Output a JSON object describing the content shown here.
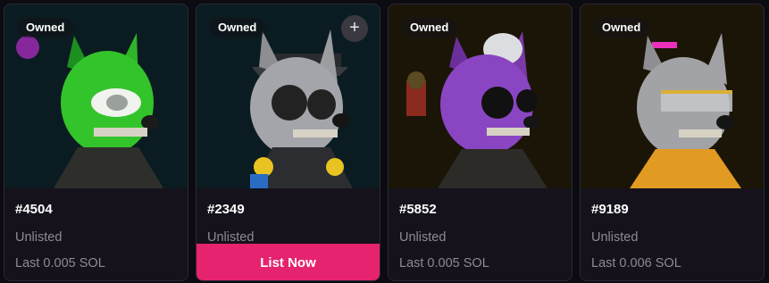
{
  "cards": [
    {
      "badge": "Owned",
      "token": "#4504",
      "status": "Unlisted",
      "last": "Last 0.005 SOL"
    },
    {
      "badge": "Owned",
      "token": "#2349",
      "status": "Unlisted",
      "last": "",
      "action": "List Now",
      "has_add": true
    },
    {
      "badge": "Owned",
      "token": "#5852",
      "status": "Unlisted",
      "last": "Last 0.005 SOL"
    },
    {
      "badge": "Owned",
      "token": "#9189",
      "status": "Unlisted",
      "last": "Last 0.006 SOL"
    }
  ],
  "icons": {
    "add": "plus-icon"
  },
  "colors": {
    "accent": "#e6236e",
    "card_bg": "#15121c",
    "page_bg": "#0d0b12",
    "muted_text": "#8d8a95"
  }
}
